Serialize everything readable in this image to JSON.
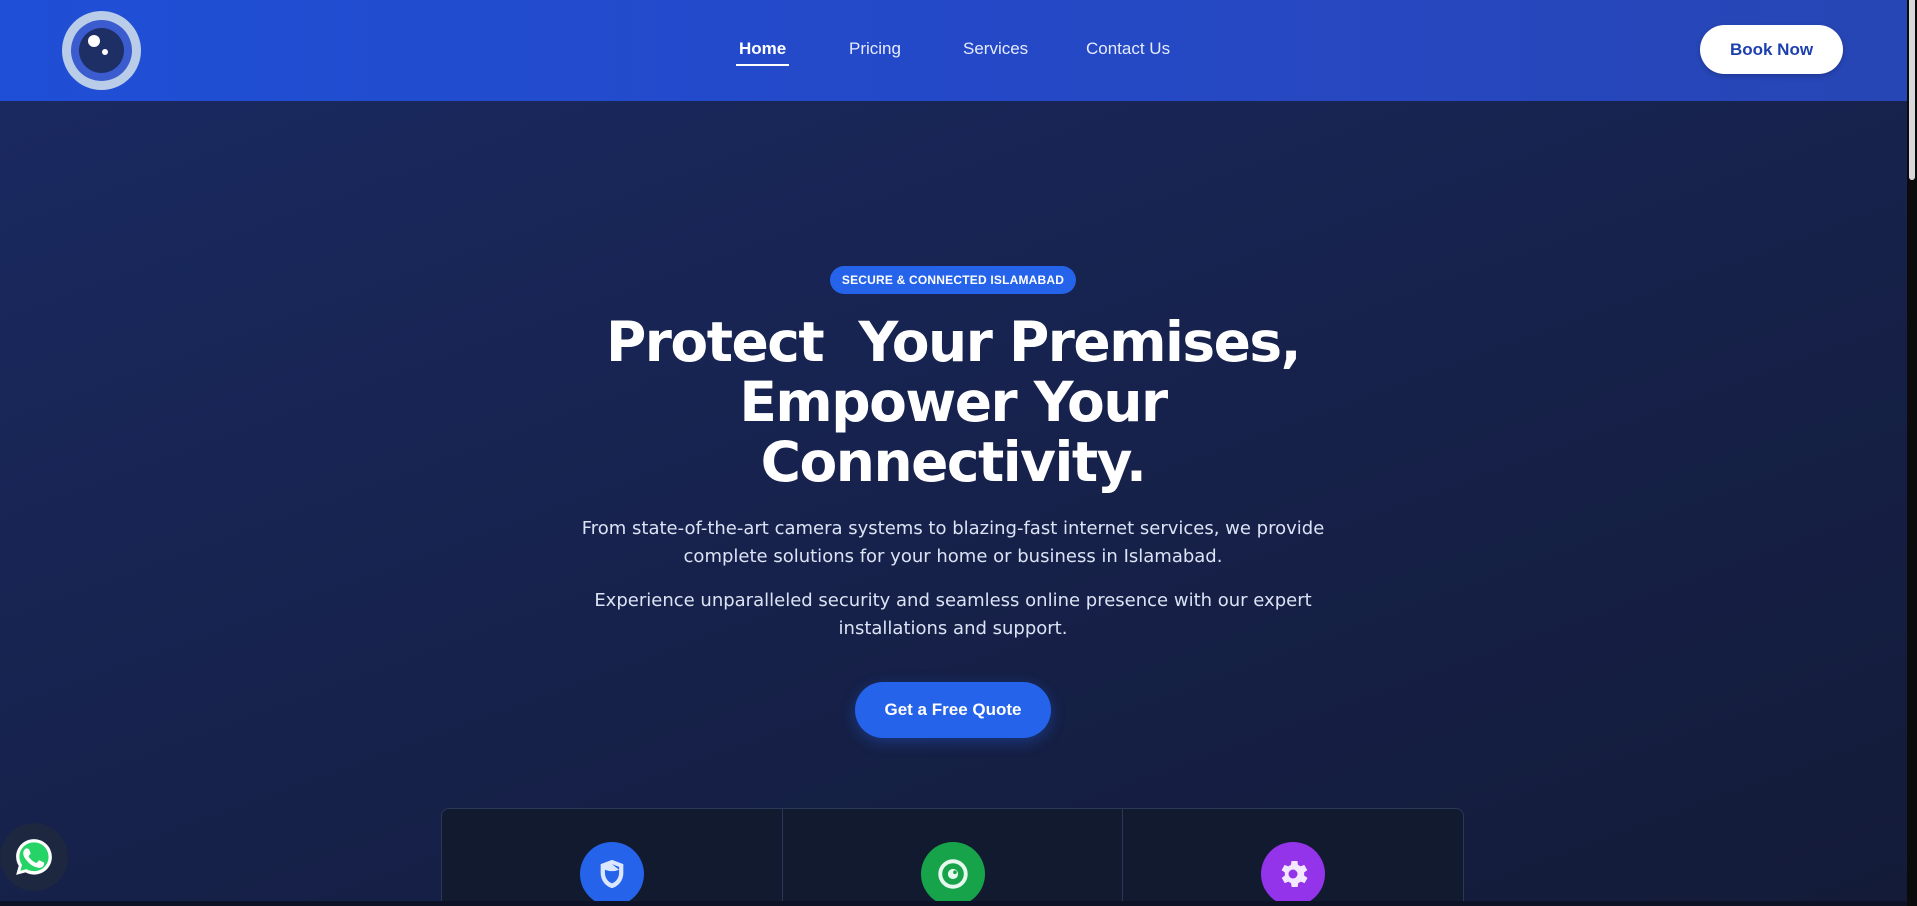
{
  "header": {
    "logo_icon": "camera-lens-icon",
    "nav": [
      {
        "label": "Home",
        "active": true
      },
      {
        "label": "Pricing",
        "active": false
      },
      {
        "label": "Services",
        "active": false
      },
      {
        "label": "Contact Us",
        "active": false
      }
    ],
    "book_label": "Book Now"
  },
  "hero": {
    "badge": "SECURE & CONNECTED ISLAMABAD",
    "headline_line1": "Protect  Your Premises,",
    "headline_line2": "Empower Your",
    "headline_line3": "Connectivity.",
    "paragraph1": "From state-of-the-art camera systems to blazing-fast internet services, we provide complete solutions for your home or business in Islamabad.",
    "paragraph2": "Experience unparalleled security and seamless online presence with our expert installations and support.",
    "cta_label": "Get a Free Quote"
  },
  "features": [
    {
      "icon": "shield-icon",
      "color": "#2563eb"
    },
    {
      "icon": "camera-icon",
      "color": "#16a34a"
    },
    {
      "icon": "gear-icon",
      "color": "#9333ea"
    }
  ],
  "floating": {
    "icon": "whatsapp-icon"
  },
  "colors": {
    "header_bg": "#1f4fd6",
    "accent": "#2563eb",
    "hero_bg": "#17234f"
  }
}
